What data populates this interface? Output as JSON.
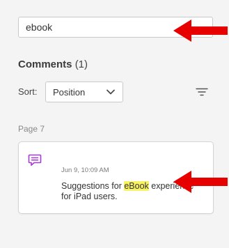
{
  "search": {
    "value": "ebook"
  },
  "comments": {
    "heading": "Comments",
    "count": "(1)"
  },
  "sort": {
    "label": "Sort:",
    "selected": "Position"
  },
  "page_group": {
    "label": "Page 7"
  },
  "comment": {
    "date": "Jun 9, 10:09 AM",
    "text_before": "Suggestions for ",
    "highlighted": "eBook",
    "text_after": " experience for iPad users."
  },
  "icons": {
    "comment": "comment-bubble-icon",
    "sort_chevron": "chevron-down-icon",
    "filter": "filter-icon",
    "annotation": "arrow-left-icon"
  },
  "colors": {
    "background": "#f4f4f4",
    "comment_icon": "#a23bd6",
    "highlight": "#f8f266",
    "annotation_arrow": "#e60000"
  }
}
